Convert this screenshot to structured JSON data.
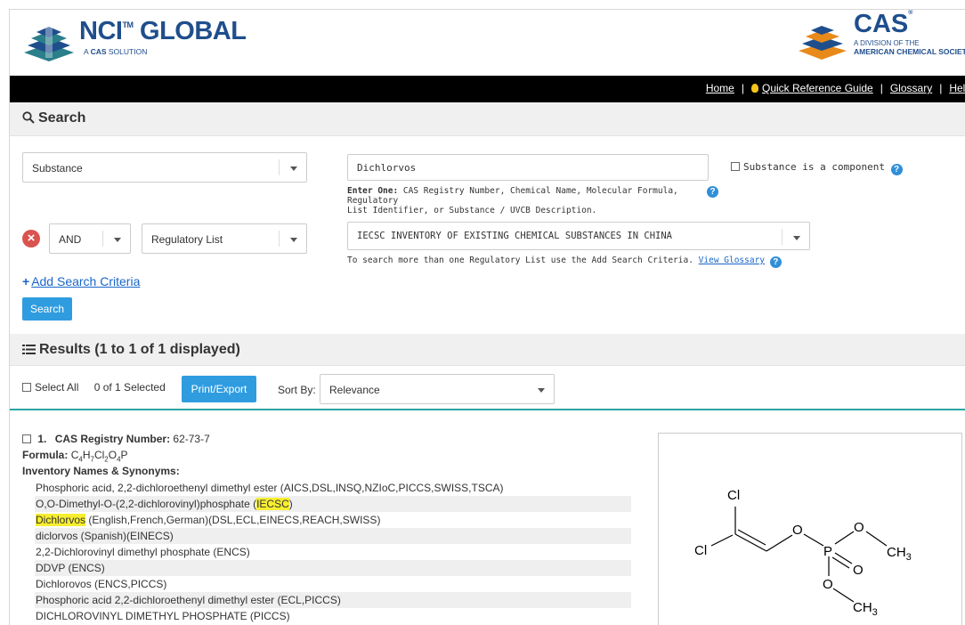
{
  "header": {
    "nci_brand": "NCI",
    "nci_tm": "TM",
    "nci_global": "GLOBAL",
    "nci_tagline_prefix": "A ",
    "nci_tagline_bold": "CAS",
    "nci_tagline_suffix": " SOLUTION",
    "cas_brand": "CAS",
    "cas_reg": "®",
    "cas_sub1": "A DIVISION OF THE",
    "cas_sub2": "AMERICAN CHEMICAL SOCIETY"
  },
  "nav": {
    "home": "Home",
    "quick_ref": "Quick Reference Guide",
    "glossary": "Glossary",
    "help": "Help"
  },
  "search": {
    "section_title": "Search",
    "field1_type": "Substance",
    "field1_value": "Dichlorvos",
    "component_label": "Substance is a component",
    "hint_bold": "Enter One:",
    "hint_line1": " CAS Registry Number, Chemical Name, Molecular Formula, Regulatory",
    "hint_line2": "List Identifier, or Substance / UVCB Description.",
    "operator": "AND",
    "field2_type": "Regulatory List",
    "field2_value": "IECSC INVENTORY OF EXISTING CHEMICAL SUBSTANCES IN CHINA",
    "list_hint": "To search more than one Regulatory List use the Add Search Criteria. ",
    "list_hint_link": "View Glossary",
    "add_criteria": "Add Search Criteria",
    "search_button": "Search"
  },
  "results": {
    "section_title": "Results (1 to 1 of 1 displayed)",
    "select_all": "Select All",
    "selected_count": "0 of 1 Selected",
    "print_export": "Print/Export",
    "sort_by_label": "Sort By:",
    "sort_by_value": "Relevance"
  },
  "record": {
    "index": "1.",
    "cas_label": "CAS Registry Number:",
    "cas_number": "62-73-7",
    "formula_label": "Formula:",
    "formula_parts": [
      "C",
      "4",
      "H",
      "7",
      "Cl",
      "2",
      "O",
      "4",
      "P"
    ],
    "inventory_label": "Inventory Names & Synonyms:",
    "syn1": "Phosphoric acid, 2,2-dichloroethenyl dimethyl ester (AICS,DSL,INSQ,NZIoC,PICCS,SWISS,TSCA)",
    "syn2_pre": "O,O-Dimethyl-O-(2,2-dichlorovinyl)phosphate (",
    "syn2_hl": "IECSC",
    "syn2_post": ")",
    "syn3_hl": "Dichlorvos",
    "syn3_post": " (English,French,German)(DSL,ECL,EINECS,REACH,SWISS)",
    "syn4": "diclorvos (Spanish)(EINECS)",
    "syn5": "2,2-Dichlorovinyl dimethyl phosphate (ENCS)",
    "syn6": "DDVP (ENCS)",
    "syn7": "Dichlorovos (ENCS,PICCS)",
    "syn8": "Phosphoric acid 2,2-dichloroethenyl dimethyl ester (ECL,PICCS)",
    "syn9": "DICHLOROVINYL DIMETHYL PHOSPHATE (PICCS)"
  },
  "structure": {
    "cl1": "Cl",
    "cl2": "Cl",
    "o1": "O",
    "o2": "O",
    "o3": "O",
    "o4": "O",
    "p": "P",
    "ch3_1": "CH",
    "ch3_1_sub": "3",
    "ch3_2": "CH",
    "ch3_2_sub": "3"
  },
  "colors": {
    "brand_blue": "#1f4e8c",
    "accent_blue": "#2f9ce0",
    "link_blue": "#1a66c9",
    "teal": "#2aa6a2",
    "highlight": "#f7ee30",
    "remove_red": "#d9534f"
  }
}
